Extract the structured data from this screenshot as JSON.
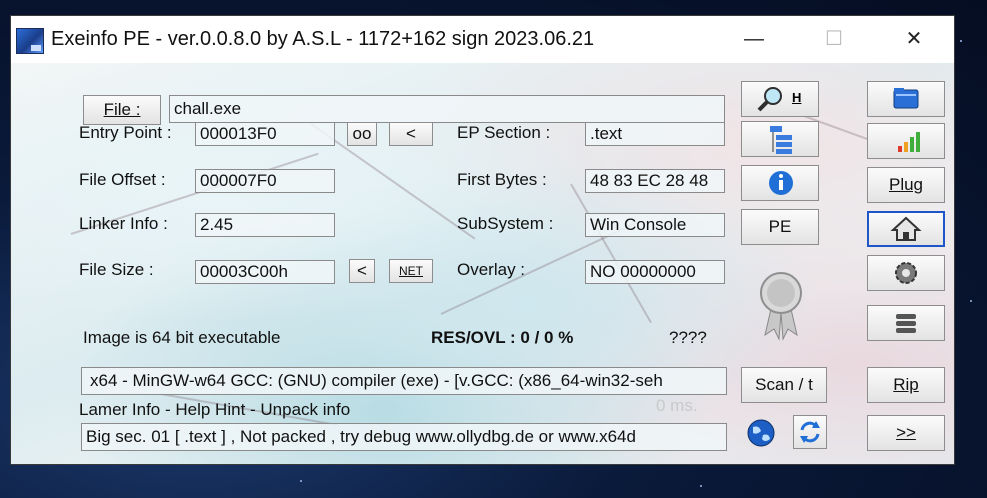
{
  "window": {
    "title": "Exeinfo PE - ver.0.0.8.0  by A.S.L -  1172+162 sign  2023.06.21",
    "minimize_glyph": "—",
    "maximize_glyph": "☐",
    "close_glyph": "✕"
  },
  "file": {
    "button_label": "File :",
    "value": "chall.exe"
  },
  "fields": {
    "entry_point": {
      "label": "Entry Point :",
      "value": "000013F0"
    },
    "file_offset": {
      "label": "File Offset :",
      "value": "000007F0"
    },
    "linker_info": {
      "label": "Linker Info :",
      "value": "2.45"
    },
    "file_size": {
      "label": "File Size :",
      "value": "00003C00h"
    },
    "ep_section": {
      "label": "EP Section :",
      "value": ".text"
    },
    "first_bytes": {
      "label": "First Bytes :",
      "value": "48 83 EC 28 48"
    },
    "subsystem": {
      "label": "SubSystem :",
      "value": "Win Console"
    },
    "overlay": {
      "label": "Overlay :",
      "value": "NO   00000000"
    }
  },
  "small_buttons": {
    "oo": "oo",
    "back_ep": "<",
    "back_size": "<",
    "net": "NET"
  },
  "status": {
    "image_bits": "Image is 64 bit executable",
    "res_ovl": "RES/OVL : 0 / 0 %",
    "unknown": "????"
  },
  "detect": {
    "compiler": "x64 - MinGW-w64 GCC: (GNU) compiler (exe) - [v.GCC: (x86_64-win32-seh",
    "hint_header": "Lamer Info - Help Hint - Unpack info",
    "time": "0 ms.",
    "hint": "Big sec. 01 [ .text ] , Not packed , try debug www.ollydbg.de or www.x64d"
  },
  "mid_buttons": {
    "hex_label": "H",
    "pe_label": "PE",
    "scan_label": "Scan / t"
  },
  "right_buttons": {
    "plug_label": "Plug",
    "rip_label": "Rip",
    "next_label": ">>"
  },
  "icons": {
    "search": "magnifier-icon",
    "tree": "section-tree-icon",
    "info": "info-icon",
    "medal": "certificate-medal-icon",
    "globe": "globe-icon",
    "refresh": "refresh-icon",
    "folder": "folder-icon",
    "bars": "signal-bars-icon",
    "home": "home-icon",
    "gear": "gear-icon",
    "menu": "stack-menu-icon"
  },
  "colors": {
    "accent": "#1e55c8",
    "info_blue": "#1f6fd6"
  }
}
